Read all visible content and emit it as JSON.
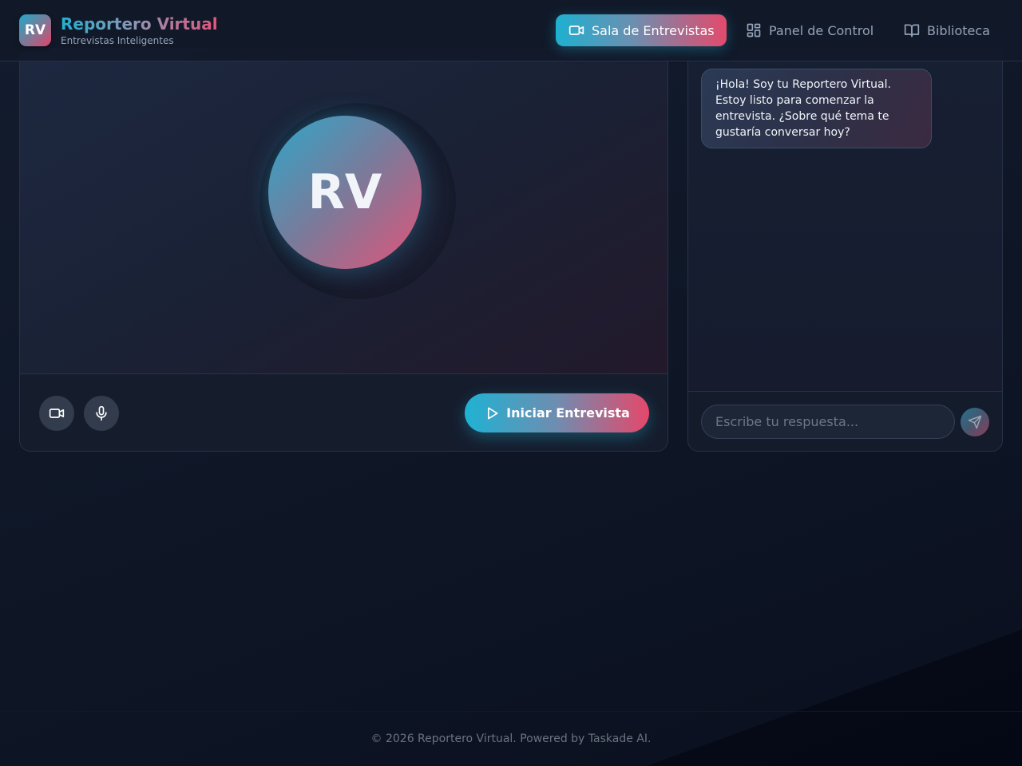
{
  "header": {
    "logo_text": "RV",
    "brand_title": "Reportero Virtual",
    "brand_subtitle": "Entrevistas Inteligentes",
    "nav": [
      {
        "label": "Sala de Entrevistas",
        "icon": "video-camera-icon",
        "active": true
      },
      {
        "label": "Panel de Control",
        "icon": "dashboard-grid-icon",
        "active": false
      },
      {
        "label": "Biblioteca",
        "icon": "open-book-icon",
        "active": false
      }
    ]
  },
  "video": {
    "avatar_text": "RV",
    "controls": {
      "camera_icon": "video-camera-icon",
      "mic_icon": "microphone-icon"
    },
    "start_button": "Iniciar Entrevista",
    "start_icon": "play-icon"
  },
  "chat": {
    "messages": [
      {
        "text": "¡Hola! Soy tu Reportero Virtual. Estoy listo para comenzar la entrevista. ¿Sobre qué tema te gustaría conversar hoy?"
      }
    ],
    "input": {
      "placeholder": "Escribe tu respuesta...",
      "value": ""
    },
    "send_icon": "send-icon"
  },
  "footer": {
    "text": "© 2026 Reportero Virtual. Powered by Taskade AI."
  },
  "colors": {
    "accent_cyan": "#1fb0d0",
    "accent_pink": "#e44a6c",
    "background": "#0f1626"
  }
}
